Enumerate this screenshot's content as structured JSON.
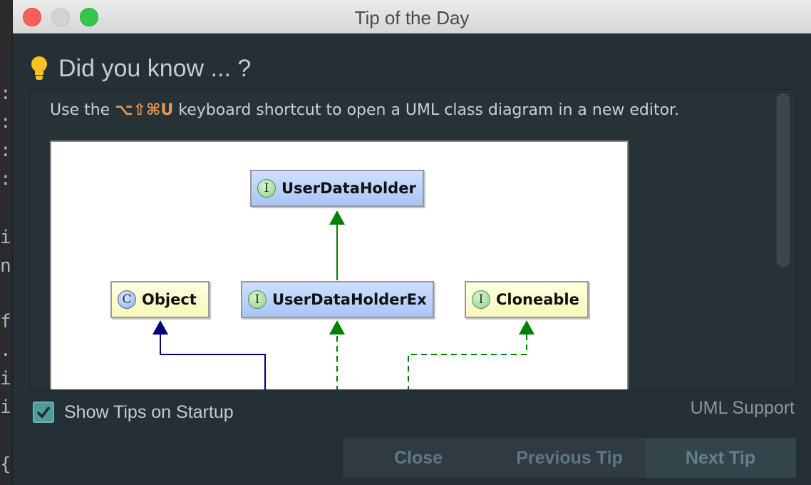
{
  "window": {
    "title": "Tip of the Day"
  },
  "heading": {
    "text": "Did you know ... ?",
    "icon": "lightbulb-icon"
  },
  "tip": {
    "prefix": "Use the ",
    "shortcut": "⌥⇧⌘U",
    "suffix": " keyboard shortcut to open a UML class diagram in a new editor.",
    "diagram": {
      "nodes": [
        {
          "label": "UserDataHolder",
          "kind": "I"
        },
        {
          "label": "Object",
          "kind": "C"
        },
        {
          "label": "UserDataHolderEx",
          "kind": "I"
        },
        {
          "label": "Cloneable",
          "kind": "I"
        }
      ]
    }
  },
  "footer": {
    "show_tips_label": "Show Tips on Startup",
    "show_tips_checked": true,
    "source": "UML Support"
  },
  "buttons": {
    "close": "Close",
    "previous": "Previous Tip",
    "next": "Next Tip"
  },
  "colors": {
    "accent": "#4e9b9c",
    "shortcut": "#e39a55",
    "realization": "#008000",
    "extends": "#000080"
  }
}
